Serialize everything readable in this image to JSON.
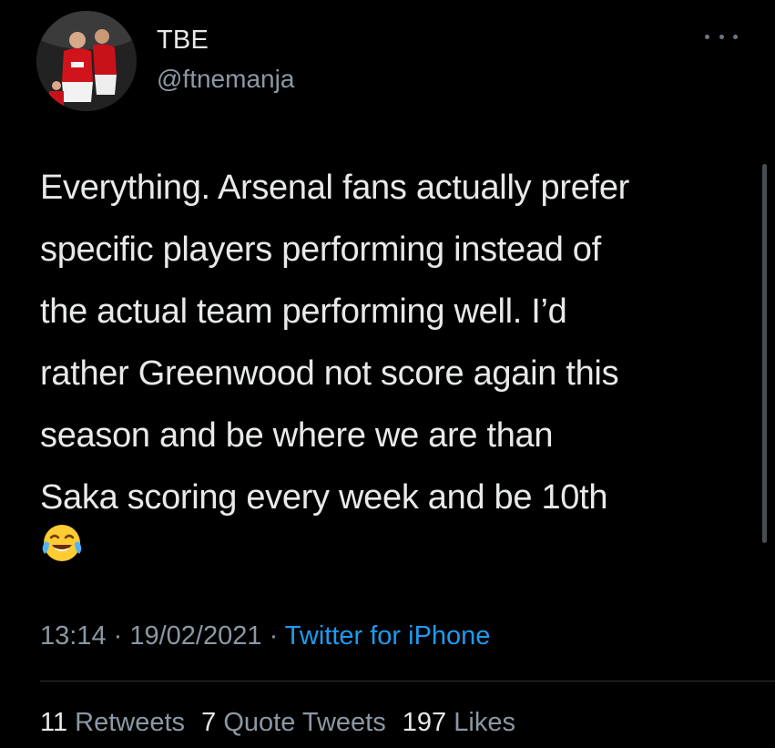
{
  "user": {
    "display_name": "TBE",
    "handle": "@ftnemanja",
    "avatar_icon": "profile-photo-footballers"
  },
  "more_icon": "more-horizontal-icon",
  "tweet": {
    "lines": [
      "Everything. Arsenal fans actually prefer",
      "specific players performing instead of",
      "the actual team performing well. I’d",
      "rather Greenwood not score again this",
      "season and be where we are than",
      "Saka scoring every week and be 10th"
    ],
    "emoji": "face-with-tears-of-joy-emoji"
  },
  "meta": {
    "time": "13:14",
    "separator1": " · ",
    "date": "19/02/2021",
    "separator2": " · ",
    "source": "Twitter for iPhone"
  },
  "stats": {
    "retweets_count": "11",
    "retweets_label": "Retweets",
    "quotes_count": "7",
    "quotes_label": "Quote Tweets",
    "likes_count": "197",
    "likes_label": "Likes"
  },
  "colors": {
    "background": "#000000",
    "text": "#e7e9ea",
    "secondary": "#8b98a5",
    "link": "#1d9bf0"
  }
}
